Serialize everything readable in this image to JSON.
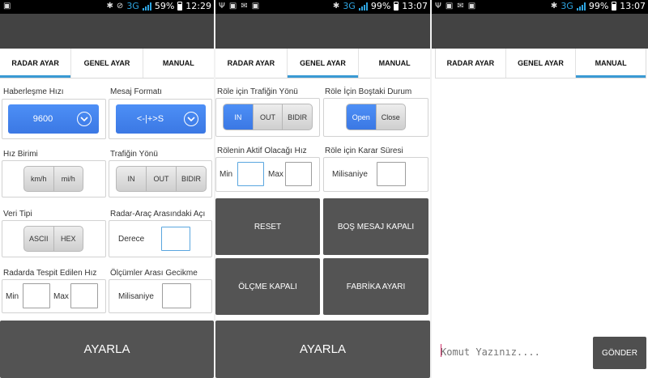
{
  "screens": [
    {
      "status": {
        "battery": "59%",
        "time": "12:29",
        "network": "3G"
      }
    },
    {
      "status": {
        "battery": "99%",
        "time": "13:07",
        "network": "3G"
      }
    },
    {
      "status": {
        "battery": "99%",
        "time": "13:07",
        "network": "3G"
      }
    }
  ],
  "tabs": {
    "radar": "RADAR AYAR",
    "general": "GENEL AYAR",
    "manual": "MANUAL"
  },
  "radar": {
    "baud_label": "Haberleşme Hızı",
    "baud_value": "9600",
    "msg_format_label": "Mesaj Formatı",
    "msg_format_value": "<-|+>S",
    "speed_unit_label": "Hız Birimi",
    "speed_unit_options": [
      "km/h",
      "mi/h"
    ],
    "traffic_dir_label": "Trafiğin Yönü",
    "traffic_dir_options": [
      "IN",
      "OUT",
      "BIDIR"
    ],
    "data_type_label": "Veri Tipi",
    "data_type_options": [
      "ASCII",
      "HEX"
    ],
    "angle_label": "Radar-Araç Arasındaki Açı",
    "angle_field_label": "Derece",
    "detect_speed_label": "Radarda Tespit Edilen Hız",
    "min_label": "Min",
    "max_label": "Max",
    "delay_label": "Ölçümler Arası Gecikme",
    "delay_field_label": "Milisaniye",
    "apply_button": "AYARLA"
  },
  "general": {
    "relay_dir_label": "Röle için Trafiğin Yönü",
    "relay_dir_options": [
      "IN",
      "OUT",
      "BIDIR"
    ],
    "relay_dir_selected": "IN",
    "relay_idle_label": "Röle İçin Boştaki Durum",
    "relay_idle_options": [
      "Open",
      "Close"
    ],
    "relay_idle_selected": "Open",
    "relay_speed_label": "Rölenin Aktif Olacağı Hız",
    "min_label": "Min",
    "max_label": "Max",
    "relay_decision_label": "Röle için Karar Süresi",
    "decision_field_label": "Milisaniye",
    "reset_button": "RESET",
    "empty_msg_button": "BOŞ MESAJ KAPALI",
    "measure_button": "ÖLÇME KAPALI",
    "factory_button": "FABRİKA AYARI",
    "apply_button": "AYARLA"
  },
  "manual": {
    "command_placeholder": "Komut Yazınız....",
    "send_button": "GÖNDER"
  },
  "colors": {
    "accent": "#3a9ad4",
    "selected_blue": "#4d8ff6",
    "dark_button": "#535353",
    "appbar": "#434343"
  }
}
